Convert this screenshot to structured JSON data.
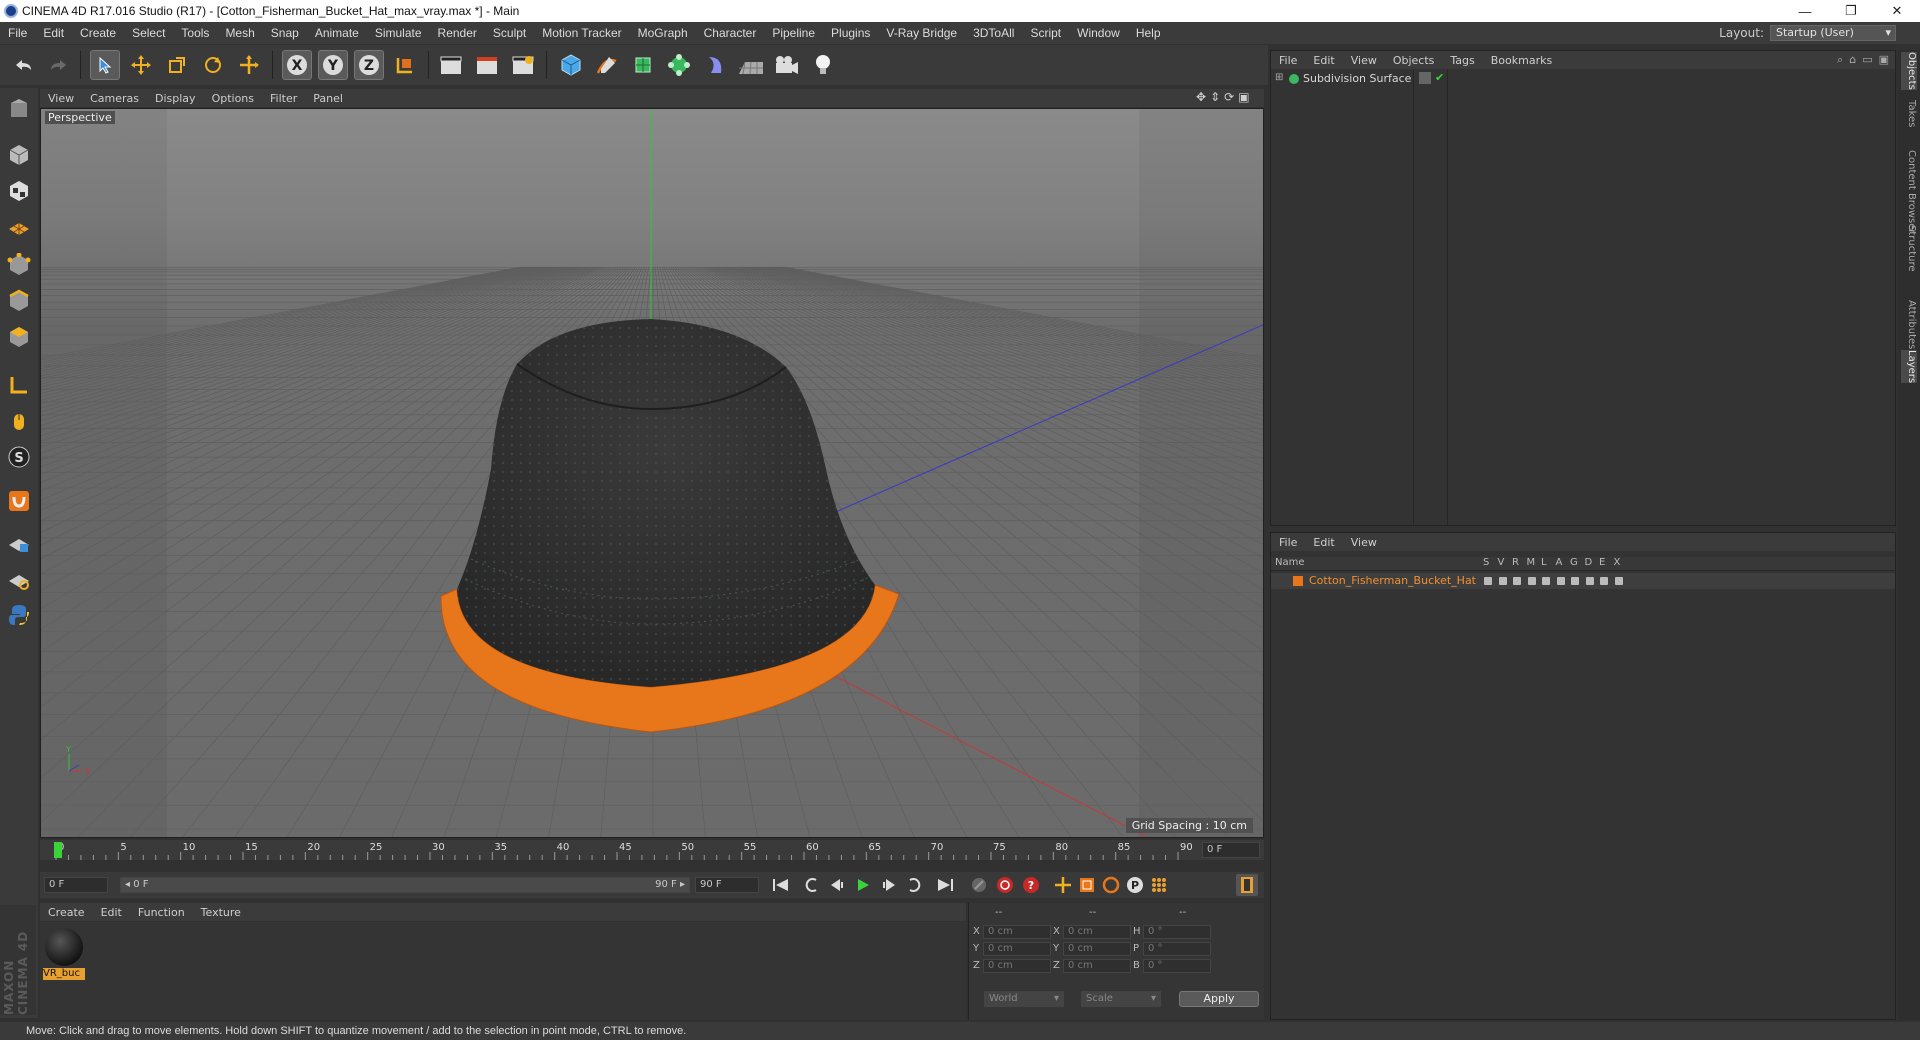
{
  "window": {
    "title": "CINEMA 4D R17.016 Studio (R17) - [Cotton_Fisherman_Bucket_Hat_max_vray.max *] - Main",
    "controls": [
      "—",
      "❐",
      "✕"
    ]
  },
  "menubar": {
    "items": [
      "File",
      "Edit",
      "Create",
      "Select",
      "Tools",
      "Mesh",
      "Snap",
      "Animate",
      "Simulate",
      "Render",
      "Sculpt",
      "Motion Tracker",
      "MoGraph",
      "Character",
      "Pipeline",
      "Plugins",
      "V-Ray Bridge",
      "3DToAll",
      "Script",
      "Window",
      "Help"
    ],
    "layout_label": "Layout:",
    "layout_value": "Startup (User)"
  },
  "viewport": {
    "menu": [
      "View",
      "Cameras",
      "Display",
      "Options",
      "Filter",
      "Panel"
    ],
    "label": "Perspective",
    "grid_spacing": "Grid Spacing : 10 cm"
  },
  "timeline": {
    "ticks": [
      "0",
      "5",
      "10",
      "15",
      "20",
      "25",
      "30",
      "35",
      "40",
      "45",
      "50",
      "55",
      "60",
      "65",
      "70",
      "75",
      "80",
      "85",
      "90"
    ],
    "current_frame": "0 F",
    "start_field": "0 F",
    "range_start": "◂ 0 F",
    "range_end": "90 F ▸",
    "end_field": "90 F"
  },
  "materials": {
    "menu": [
      "Create",
      "Edit",
      "Function",
      "Texture"
    ],
    "items": [
      {
        "name": "VR_buc"
      }
    ]
  },
  "coords": {
    "headers": [
      "--",
      "--",
      "--"
    ],
    "rows": [
      {
        "a": "X",
        "av": "0 cm",
        "b": "X",
        "bv": "0 cm",
        "c": "H",
        "cv": "0 °"
      },
      {
        "a": "Y",
        "av": "0 cm",
        "b": "Y",
        "bv": "0 cm",
        "c": "P",
        "cv": "0 °"
      },
      {
        "a": "Z",
        "av": "0 cm",
        "b": "Z",
        "bv": "0 cm",
        "c": "B",
        "cv": "0 °"
      }
    ],
    "mode": "World",
    "scale_mode": "Scale",
    "apply": "Apply"
  },
  "object_manager": {
    "menu": [
      "File",
      "Edit",
      "View",
      "Objects",
      "Tags",
      "Bookmarks"
    ],
    "objects": [
      {
        "name": "Subdivision Surface"
      }
    ]
  },
  "layer_manager": {
    "menu": [
      "File",
      "Edit",
      "View"
    ],
    "columns": [
      "Name",
      "S",
      "V",
      "R",
      "M",
      "L",
      "A",
      "G",
      "D",
      "E",
      "X"
    ],
    "layers": [
      {
        "name": "Cotton_Fisherman_Bucket_Hat",
        "color": "#e8761a"
      }
    ]
  },
  "right_tabs": [
    "Objects",
    "Takes",
    "Content Browser",
    "Structure",
    "Attributes",
    "Layers"
  ],
  "status": "Move: Click and drag to move elements. Hold down SHIFT to quantize movement / add to the selection in point mode, CTRL to remove.",
  "brand": "MAXON CINEMA 4D",
  "colors": {
    "accent": "#e8761a",
    "bg": "#313131",
    "viewport": "#6e6e6e"
  }
}
